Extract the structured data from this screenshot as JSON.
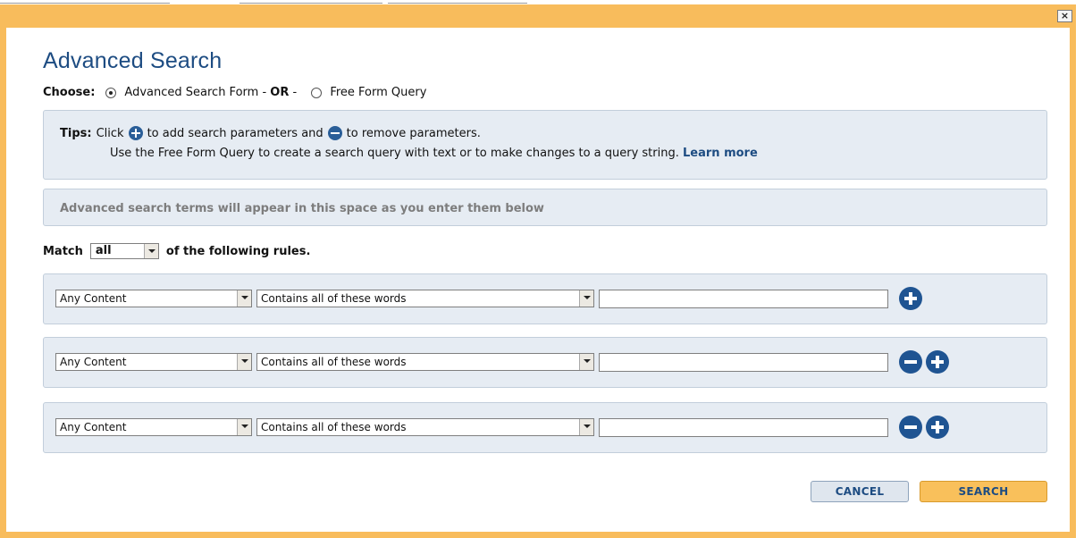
{
  "dialog": {
    "title": "Advanced Search",
    "close_label": "×"
  },
  "choose": {
    "label": "Choose:",
    "option_form": "Advanced Search Form",
    "separator_pre": " - ",
    "or": "OR",
    "separator_post": " - ",
    "option_free": "Free Form Query",
    "selected": "Advanced Search Form"
  },
  "tips": {
    "label": "Tips:",
    "part1": "Click",
    "part2": "to add search parameters and",
    "part3": "to remove parameters.",
    "line2": "Use the Free Form Query to create a search query with text or to make changes to a query string.",
    "learn_more": "Learn more"
  },
  "terms": {
    "placeholder": "Advanced search terms will appear in this space as you enter them below"
  },
  "match": {
    "prefix": "Match",
    "value": "all",
    "suffix": "of the following rules."
  },
  "rules": [
    {
      "field": "Any Content",
      "condition": "Contains all of these words",
      "value": ""
    },
    {
      "field": "Any Content",
      "condition": "Contains all of these words",
      "value": ""
    },
    {
      "field": "Any Content",
      "condition": "Contains all of these words",
      "value": ""
    }
  ],
  "buttons": {
    "cancel": "CANCEL",
    "search": "SEARCH"
  },
  "colors": {
    "frame": "#f8bc5c",
    "accent": "#1d4c82",
    "panel": "#e6ecf3"
  }
}
